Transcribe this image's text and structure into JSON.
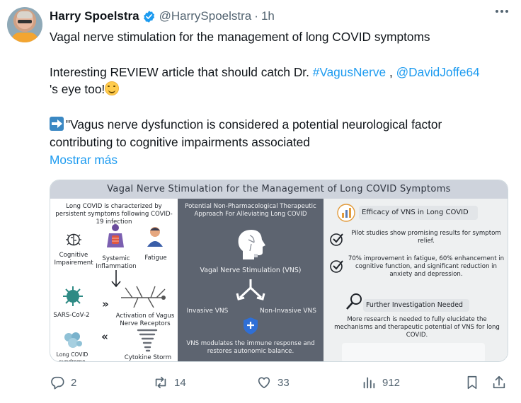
{
  "tweet": {
    "display_name": "Harry Spoelstra",
    "handle": "@HarrySpoelstra",
    "separator": "·",
    "time": "1h",
    "line1": "Vagal nerve stimulation for the management of long COVID symptoms",
    "line2_prefix": "Interesting REVIEW article that should catch Dr. ",
    "hashtag": "#VagusNerve",
    "line2_comma": " , ",
    "mention": "@DavidJoffe64",
    "line3": "'s eye too!",
    "quote_line1": "\"Vagus nerve dysfunction is considered a potential neurological factor",
    "quote_line2": "contributing to cognitive impairments associated",
    "show_more": "Mostrar más"
  },
  "infographic": {
    "title": "Vagal Nerve Stimulation for the Management of Long COVID Symptoms",
    "left_intro": "Long COVID is characterized by persistent symptoms following COVID-19 infection",
    "cognitive": "Cognitive Impairement",
    "systemic": "Systemic Inflammation",
    "fatigue": "Fatigue",
    "sars": "SARS-CoV-2",
    "activation": "Activation of Vagus Nerve Receptors",
    "long_covid_syndrome": "Long COVID syndrome",
    "cytokine": "Cytokine Storm",
    "mid_heading": "Potential Non-Pharmacological Therapeutic Approach For Alleviating Long COVID",
    "vns": "Vagal Nerve Stimulation (VNS)",
    "invasive": "Invasive VNS",
    "non_invasive": "Non-Invasive VNS",
    "mid_bottom": "VNS modulates the immune response and restores autonomic balance.",
    "efficacy_title": "Efficacy of VNS in Long COVID",
    "pilot": "Pilot studies show promising results for symptom relief.",
    "improvement": "70% improvement in fatigue, 60% enhancement in cognitive function, and significant reduction in anxiety and depression.",
    "further_title": "Further Investigation Needed",
    "further_text": "More research is needed to fully elucidate the mechanisms and therapeutic potential of VNS for long COVID."
  },
  "actions": {
    "replies": "2",
    "reposts": "14",
    "likes": "33",
    "views": "912"
  },
  "colors": {
    "link": "#1d9bf0",
    "verified": "#1d9bf0",
    "secondary_text": "#536471"
  }
}
